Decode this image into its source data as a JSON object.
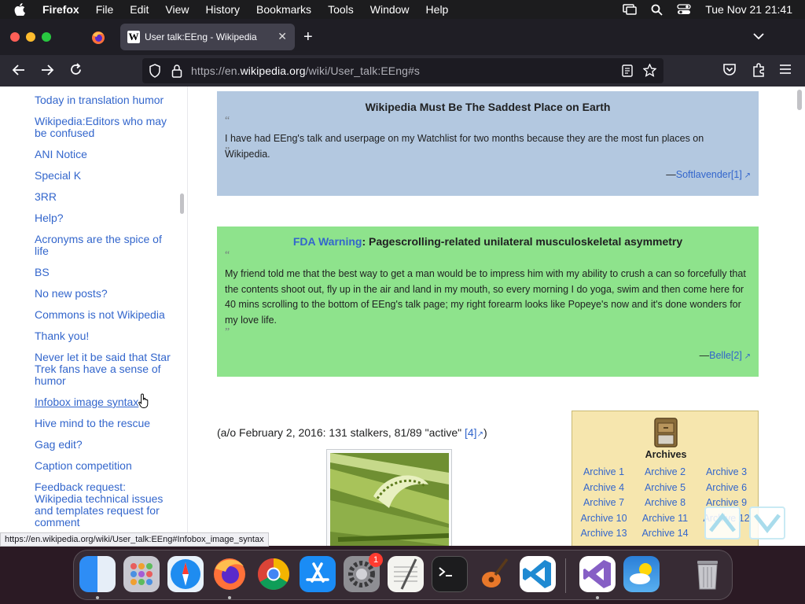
{
  "menubar": {
    "app": "Firefox",
    "items": [
      "File",
      "Edit",
      "View",
      "History",
      "Bookmarks",
      "Tools",
      "Window",
      "Help"
    ],
    "clock": "Tue Nov 21  21:41"
  },
  "tab": {
    "title": "User talk:EEng - Wikipedia",
    "favicon_letter": "W"
  },
  "url": {
    "prefix": "https://en.",
    "domain": "wikipedia.org",
    "path": "/wiki/User_talk:EEng#s"
  },
  "sidebar": {
    "items": [
      "Today in translation humor",
      "Wikipedia:Editors who may be confused",
      "ANI Notice",
      "Special K",
      "3RR",
      "Help?",
      "Acronyms are the spice of life",
      "BS",
      "No new posts?",
      "Commons is not Wikipedia",
      "Thank you!",
      "Never let it be said that Star Trek fans have a sense of humor",
      "Infobox image syntax",
      "Hive mind to the rescue",
      "Gag edit?",
      "Caption competition",
      "Feedback request: Wikipedia technical issues and templates request for comment"
    ]
  },
  "quote1": {
    "title": "Wikipedia Must Be The Saddest Place on Earth",
    "open_mark": "“",
    "close_mark": "”",
    "text": "I have had EEng's talk and userpage on my Watchlist for two months because they are the most fun places on Wikipedia.",
    "sig_dash": "—",
    "sig_link": "Softlavender[1]"
  },
  "quote2": {
    "title_link": "FDA Warning",
    "title_rest": ": Pagescrolling-related unilateral musculoskeletal asymmetry",
    "open_mark": "“",
    "close_mark": "”",
    "text": "My friend told me that the best way to get a man would be to impress him with my ability to crush a can so forcefully that the contents shoot out, fly up in the air and land in my mouth, so every morning I do yoga, swim and then come here for 40 mins scrolling to the bottom of EEng's talk page; my right forearm looks like Popeye's now and it's done wonders for my love life.",
    "sig_dash": "—",
    "sig_link": "Belle[2]"
  },
  "stalkers": {
    "text": "(a/o February 2, 2016: 131 stalkers, 81/89 \"active\" ",
    "ref": "[4]",
    "close": ")"
  },
  "archives": {
    "title": "Archives",
    "links": [
      "Archive 1",
      "Archive 2",
      "Archive 3",
      "Archive 4",
      "Archive 5",
      "Archive 6",
      "Archive 7",
      "Archive 8",
      "Archive 9",
      "Archive 10",
      "Archive 11",
      "Archive 12",
      "Archive 13",
      "Archive 14"
    ]
  },
  "statusbar": {
    "text": "https://en.wikipedia.org/wiki/User_talk:EEng#Infobox_image_syntax"
  },
  "dock": {
    "apps": [
      "finder-icon",
      "launchpad-icon",
      "safari-icon",
      "firefox-icon",
      "chrome-icon",
      "app-store-icon",
      "system-settings-icon",
      "textedit-icon",
      "terminal-icon",
      "garageband-icon",
      "vscode-icon",
      "visual-studio-icon",
      "weather-icon",
      "trash-icon"
    ],
    "settings_badge": "1"
  },
  "colors": {
    "link": "#3366cc",
    "quote_blue": "#b3c8e0",
    "quote_green": "#8ee38c",
    "archives_bg": "#f6e6ae"
  }
}
